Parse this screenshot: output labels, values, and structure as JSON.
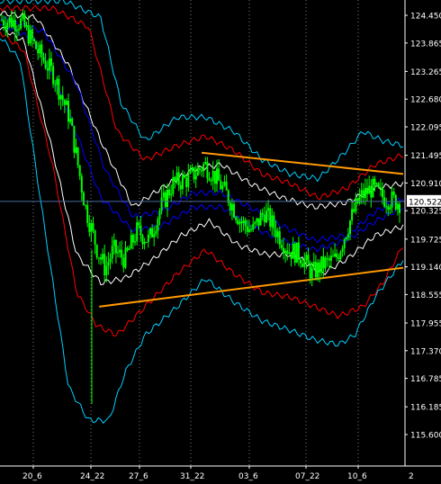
{
  "chart_data": {
    "type": "candlestick",
    "colors": {
      "background": "#000000",
      "candles": "#00ff00",
      "white_band": "#ffffff",
      "red_band": "#ff0000",
      "blue_band": "#0000ff",
      "cyan_band": "#00cfff",
      "trendline": "#ff9900",
      "current_price_line": "#4d6a9e",
      "current_price_badge_bg": "#ffffff",
      "current_price_badge_text": "#000000",
      "grid": "#7a7a7a",
      "axis_text": "#ffffff"
    },
    "y_axis": {
      "range": [
        115.3,
        124.75
      ],
      "ticks": [
        "124.450",
        "123.865",
        "123.265",
        "122.680",
        "122.095",
        "121.495",
        "120.910",
        "120.325",
        "119.725",
        "119.140",
        "118.555",
        "117.955",
        "117.370",
        "116.785",
        "116.185",
        "115.600"
      ]
    },
    "x_axis": {
      "ticks": [
        "20_6",
        "24_22",
        "27_6",
        "31_22",
        "03_6",
        "07_22",
        "10_6"
      ],
      "corner_label": "2"
    },
    "current_price": "120.522",
    "trendlines": {
      "upper": [
        [
          0.5,
          121.55
        ],
        [
          1.0,
          121.1
        ]
      ],
      "lower": [
        [
          0.246,
          118.3
        ],
        [
          1.0,
          119.12
        ]
      ]
    },
    "price_waypoints": [
      [
        0,
        124.35
      ],
      [
        0.05,
        124.3
      ],
      [
        0.09,
        123.7
      ],
      [
        0.13,
        123.2
      ],
      [
        0.17,
        122.3
      ],
      [
        0.21,
        120.4
      ],
      [
        0.24,
        119.5
      ],
      [
        0.26,
        119.1
      ],
      [
        0.28,
        119.5
      ],
      [
        0.31,
        119.3
      ],
      [
        0.34,
        119.9
      ],
      [
        0.37,
        119.7
      ],
      [
        0.4,
        120.4
      ],
      [
        0.43,
        120.9
      ],
      [
        0.47,
        121.0
      ],
      [
        0.51,
        121.3
      ],
      [
        0.54,
        121.0
      ],
      [
        0.57,
        120.6
      ],
      [
        0.6,
        120.1
      ],
      [
        0.63,
        119.9
      ],
      [
        0.66,
        120.3
      ],
      [
        0.69,
        119.9
      ],
      [
        0.72,
        119.5
      ],
      [
        0.75,
        119.4
      ],
      [
        0.78,
        119.0
      ],
      [
        0.81,
        119.2
      ],
      [
        0.84,
        119.3
      ],
      [
        0.87,
        120.0
      ],
      [
        0.9,
        120.6
      ],
      [
        0.93,
        120.8
      ],
      [
        0.96,
        120.6
      ],
      [
        1.0,
        120.5
      ]
    ],
    "bands": {
      "white": {
        "upper": [
          [
            0,
            124.5
          ],
          [
            0.09,
            124.4
          ],
          [
            0.17,
            123.4
          ],
          [
            0.25,
            121.8
          ],
          [
            0.33,
            120.4
          ],
          [
            0.4,
            120.8
          ],
          [
            0.48,
            121.2
          ],
          [
            0.55,
            121.3
          ],
          [
            0.62,
            120.9
          ],
          [
            0.7,
            120.6
          ],
          [
            0.78,
            120.4
          ],
          [
            0.86,
            120.5
          ],
          [
            0.93,
            120.8
          ],
          [
            1.0,
            120.9
          ]
        ],
        "lower": [
          [
            0,
            124.2
          ],
          [
            0.06,
            123.9
          ],
          [
            0.13,
            121.6
          ],
          [
            0.19,
            119.4
          ],
          [
            0.25,
            118.8
          ],
          [
            0.31,
            118.9
          ],
          [
            0.38,
            119.3
          ],
          [
            0.45,
            119.8
          ],
          [
            0.52,
            120.1
          ],
          [
            0.59,
            119.6
          ],
          [
            0.66,
            119.4
          ],
          [
            0.73,
            119.4
          ],
          [
            0.8,
            119.0
          ],
          [
            0.86,
            119.3
          ],
          [
            0.93,
            119.8
          ],
          [
            1.0,
            120.0
          ]
        ]
      },
      "blue": {
        "upper": [
          [
            0,
            124.4
          ],
          [
            0.11,
            124.1
          ],
          [
            0.19,
            123.0
          ],
          [
            0.26,
            121.2
          ],
          [
            0.33,
            120.2
          ],
          [
            0.4,
            120.3
          ],
          [
            0.48,
            120.7
          ],
          [
            0.55,
            120.7
          ],
          [
            0.62,
            120.4
          ],
          [
            0.7,
            120.0
          ],
          [
            0.78,
            119.7
          ],
          [
            0.86,
            119.8
          ],
          [
            0.93,
            120.3
          ],
          [
            1.0,
            120.6
          ]
        ],
        "lower": [
          [
            0,
            124.3
          ],
          [
            0.09,
            123.9
          ],
          [
            0.17,
            122.4
          ],
          [
            0.25,
            120.6
          ],
          [
            0.33,
            119.9
          ],
          [
            0.4,
            120.0
          ],
          [
            0.48,
            120.4
          ],
          [
            0.55,
            120.4
          ],
          [
            0.62,
            120.0
          ],
          [
            0.7,
            119.7
          ],
          [
            0.78,
            119.5
          ],
          [
            0.86,
            119.7
          ],
          [
            0.93,
            120.1
          ],
          [
            1.0,
            120.4
          ]
        ]
      },
      "red": {
        "upper": [
          [
            0,
            124.6
          ],
          [
            0.13,
            124.6
          ],
          [
            0.22,
            124.2
          ],
          [
            0.29,
            122.0
          ],
          [
            0.36,
            121.4
          ],
          [
            0.44,
            121.7
          ],
          [
            0.51,
            121.9
          ],
          [
            0.58,
            121.6
          ],
          [
            0.65,
            121.1
          ],
          [
            0.72,
            120.9
          ],
          [
            0.79,
            120.6
          ],
          [
            0.86,
            120.8
          ],
          [
            0.93,
            121.3
          ],
          [
            1.0,
            121.5
          ]
        ],
        "lower": [
          [
            0,
            124.1
          ],
          [
            0.06,
            123.7
          ],
          [
            0.13,
            121.3
          ],
          [
            0.19,
            118.6
          ],
          [
            0.24,
            117.9
          ],
          [
            0.29,
            117.7
          ],
          [
            0.36,
            118.3
          ],
          [
            0.44,
            119.0
          ],
          [
            0.51,
            119.5
          ],
          [
            0.58,
            119.0
          ],
          [
            0.65,
            118.6
          ],
          [
            0.72,
            118.5
          ],
          [
            0.78,
            118.3
          ],
          [
            0.84,
            118.1
          ],
          [
            0.9,
            118.3
          ],
          [
            0.95,
            118.8
          ],
          [
            1.0,
            119.6
          ]
        ]
      },
      "cyan": {
        "upper": [
          [
            0,
            124.75
          ],
          [
            0.16,
            124.75
          ],
          [
            0.25,
            124.4
          ],
          [
            0.3,
            122.6
          ],
          [
            0.36,
            121.8
          ],
          [
            0.44,
            122.3
          ],
          [
            0.51,
            122.3
          ],
          [
            0.58,
            122.0
          ],
          [
            0.65,
            121.4
          ],
          [
            0.72,
            121.1
          ],
          [
            0.79,
            121.0
          ],
          [
            0.86,
            121.6
          ],
          [
            0.9,
            122.0
          ],
          [
            0.95,
            121.8
          ],
          [
            1.0,
            121.7
          ]
        ],
        "lower": [
          [
            0,
            124.0
          ],
          [
            0.05,
            123.5
          ],
          [
            0.11,
            120.0
          ],
          [
            0.17,
            116.6
          ],
          [
            0.22,
            115.9
          ],
          [
            0.27,
            115.9
          ],
          [
            0.31,
            116.9
          ],
          [
            0.36,
            117.7
          ],
          [
            0.44,
            118.3
          ],
          [
            0.51,
            118.9
          ],
          [
            0.58,
            118.4
          ],
          [
            0.65,
            118.0
          ],
          [
            0.72,
            117.8
          ],
          [
            0.78,
            117.6
          ],
          [
            0.84,
            117.5
          ],
          [
            0.88,
            117.7
          ],
          [
            0.93,
            118.5
          ],
          [
            1.0,
            119.3
          ]
        ]
      }
    }
  }
}
